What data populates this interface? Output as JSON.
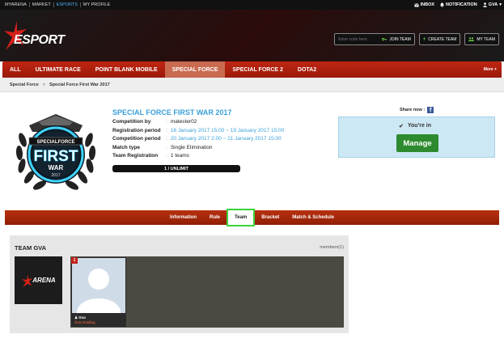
{
  "topbar": {
    "links": [
      "MYARENA",
      "MARKET",
      "ESPORTS",
      "MY PROFILE"
    ],
    "active_link": "ESPORTS",
    "inbox": "INBOX",
    "notification": "NOTIFICATION",
    "user": "GVA"
  },
  "header": {
    "logo_text": "ESPORT",
    "code_placeholder": "Enter code here",
    "join_label": "JOIN TEAM",
    "create_label": "CREATE TEAM",
    "myteam_label": "MY TEAM"
  },
  "nav": {
    "items": [
      "ALL",
      "ULTIMATE RACE",
      "POINT BLANK MOBILE",
      "SPECIAL FORCE",
      "SPECIAL FORCE 2",
      "DOTA2"
    ],
    "active": "SPECIAL FORCE",
    "more": "More +"
  },
  "breadcrumb": {
    "items": [
      "Special Force",
      "Special Force First War 2017"
    ],
    "separator": ">"
  },
  "emblem": {
    "top_text": "SPECIALFORCE",
    "big_text": "FIRST",
    "sub_text": "WAR",
    "year": "2017"
  },
  "event": {
    "title": "SPECIAL FORCE FIRST WAR 2017",
    "details": [
      {
        "label": "Competition by",
        "value": "matester02"
      },
      {
        "label": "Registration period",
        "value": "18 January 2017 15:00  ~  19 January 2017 15:00"
      },
      {
        "label": "Competition period",
        "value": "20 January 2017 2:00  ~  21 January 2017 15:00"
      },
      {
        "label": "Match type",
        "value": "Single Elimination"
      },
      {
        "label": "Team Registration",
        "value": "1 teams"
      }
    ],
    "capacity": "1 / UNLIMIT"
  },
  "share": {
    "label": "Share now :",
    "fb_icon": "f"
  },
  "status": {
    "youre_in": "You're in",
    "manage_label": "Manage"
  },
  "tabs": {
    "items": [
      "Information",
      "Rule",
      "Team",
      "Bracket",
      "Match & Schedule"
    ],
    "active": "Team"
  },
  "team": {
    "title": "TEAM GVA",
    "members_label": "members(1)",
    "logo_text": "ARENA",
    "member": {
      "rank": "1",
      "name": "Gva",
      "status": "Gva Grading"
    }
  },
  "colors": {
    "nav_red": "#c02612",
    "accent_blue": "#3aa0d8",
    "manage_green": "#2e8a2e",
    "tab_highlight": "#3cd23c"
  }
}
